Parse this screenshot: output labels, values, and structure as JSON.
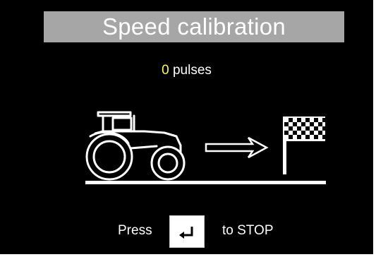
{
  "header": {
    "title": "Speed calibration"
  },
  "counter": {
    "value": "0",
    "unit": "pulses"
  },
  "footer": {
    "press_label": "Press",
    "action_label": "to STOP"
  },
  "icons": {
    "tractor": "tractor-icon",
    "arrow": "arrow-right-icon",
    "flag": "checkered-flag-icon",
    "enter": "enter-key-icon"
  },
  "colors": {
    "background": "#000000",
    "title_bar": "#a6a6a6",
    "count_value": "#ffff33",
    "text": "#ffffff"
  }
}
